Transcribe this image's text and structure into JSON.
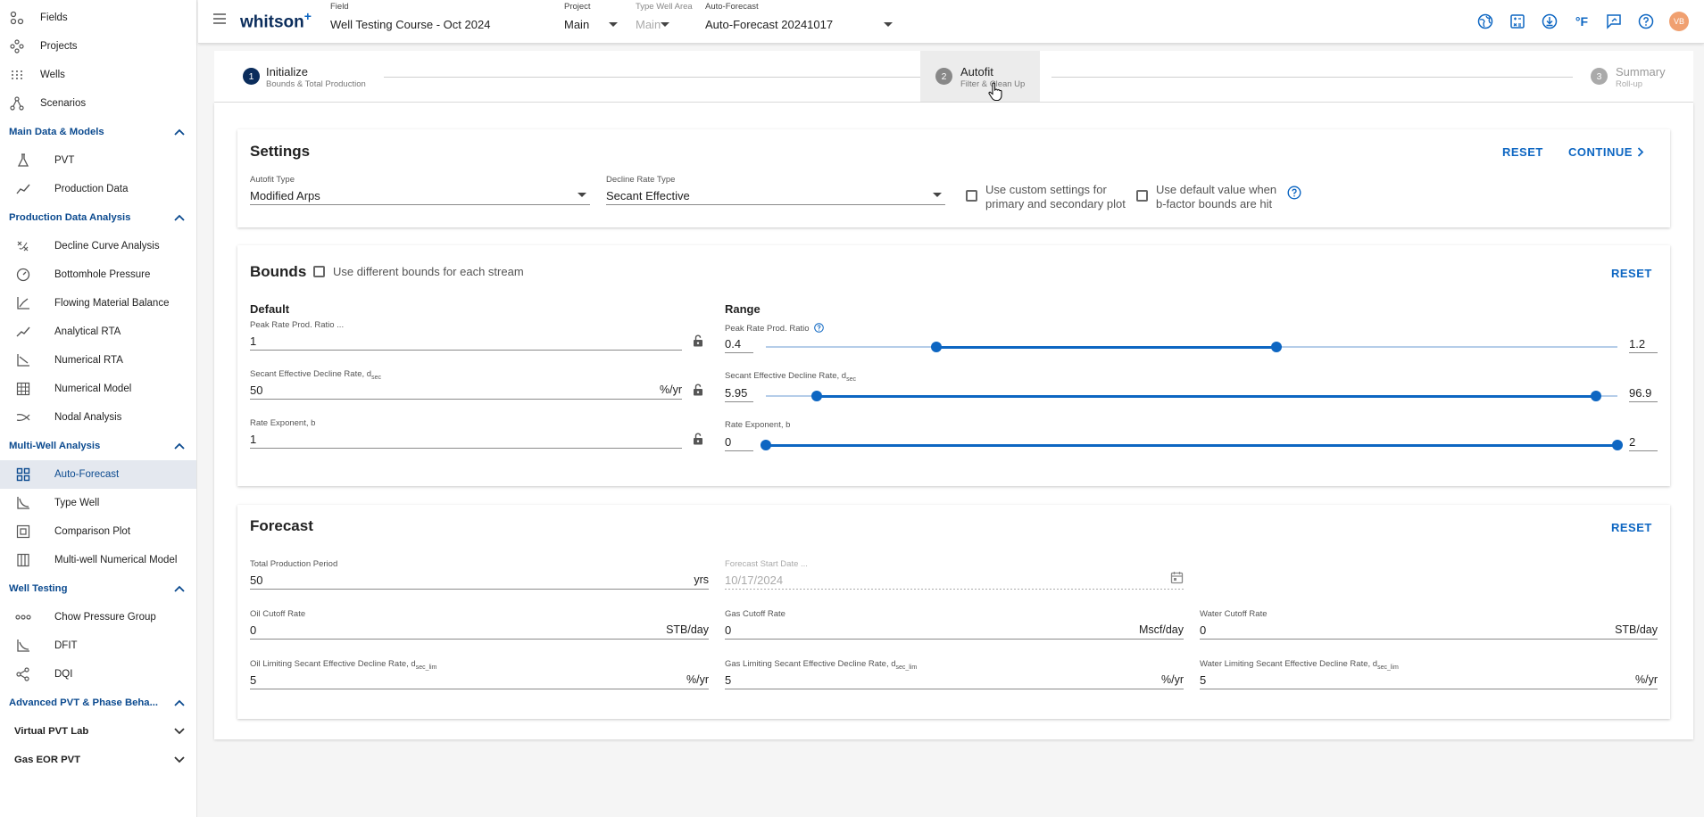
{
  "sidebar": {
    "top_items": [
      {
        "label": "Fields",
        "icon": "fields-icon"
      },
      {
        "label": "Projects",
        "icon": "projects-icon"
      },
      {
        "label": "Wells",
        "icon": "wells-icon"
      },
      {
        "label": "Scenarios",
        "icon": "scenarios-icon"
      }
    ],
    "sections": {
      "main_data": {
        "label": "Main Data & Models",
        "items": [
          {
            "label": "PVT"
          },
          {
            "label": "Production Data"
          }
        ]
      },
      "pda": {
        "label": "Production Data Analysis",
        "items": [
          {
            "label": "Decline Curve Analysis"
          },
          {
            "label": "Bottomhole Pressure"
          },
          {
            "label": "Flowing Material Balance"
          },
          {
            "label": "Analytical RTA"
          },
          {
            "label": "Numerical RTA"
          },
          {
            "label": "Numerical Model"
          },
          {
            "label": "Nodal Analysis"
          }
        ]
      },
      "mwa": {
        "label": "Multi-Well Analysis",
        "items": [
          {
            "label": "Auto-Forecast"
          },
          {
            "label": "Type Well"
          },
          {
            "label": "Comparison Plot"
          },
          {
            "label": "Multi-well Numerical Model"
          }
        ]
      },
      "wt": {
        "label": "Well Testing",
        "items": [
          {
            "label": "Chow Pressure Group"
          },
          {
            "label": "DFIT"
          },
          {
            "label": "DQI"
          }
        ]
      },
      "adv": {
        "label": "Advanced PVT & Phase Beha..."
      }
    },
    "collapsed": [
      {
        "label": "Virtual PVT Lab"
      },
      {
        "label": "Gas EOR PVT"
      }
    ]
  },
  "topbar": {
    "logo": "whitson",
    "logo_plus": "+",
    "field": {
      "caption": "Field",
      "value": "Well Testing Course - Oct 2024"
    },
    "project": {
      "caption": "Project",
      "value": "Main"
    },
    "type_well_area": {
      "caption": "Type Well Area",
      "value": "Main"
    },
    "auto_forecast": {
      "caption": "Auto-Forecast",
      "value": "Auto-Forecast 20241017"
    },
    "temp_unit": "°F",
    "avatar": "VB",
    "accent": "#0d66c2",
    "avatar_color": "#f0a070"
  },
  "stepper": {
    "steps": [
      {
        "number": "1",
        "title": "Initialize",
        "subtitle": "Bounds & Total Production"
      },
      {
        "number": "2",
        "title": "Autofit",
        "subtitle": "Filter & Clean Up"
      },
      {
        "number": "3",
        "title": "Summary",
        "subtitle": "Roll-up"
      }
    ]
  },
  "settings": {
    "title": "Settings",
    "reset": "RESET",
    "continue": "CONTINUE",
    "autofit_type": {
      "caption": "Autofit Type",
      "value": "Modified Arps"
    },
    "decline_rate_type": {
      "caption": "Decline Rate Type",
      "value": "Secant Effective"
    },
    "custom_settings": {
      "line1": "Use custom settings for",
      "line2": "primary and secondary plot",
      "checked": false
    },
    "default_value": {
      "line1": "Use default value when",
      "line2": "b-factor bounds are hit",
      "checked": false
    }
  },
  "bounds": {
    "title": "Bounds",
    "reset": "RESET",
    "diff_bounds_label": "Use different bounds for each stream",
    "default_head": "Default",
    "range_head": "Range",
    "default_fields": [
      {
        "caption": "Peak Rate Prod. Ratio ...",
        "value": "1",
        "unit": ""
      },
      {
        "caption_main": "Secant Effective Decline Rate, d",
        "caption_sub": "sec",
        "value": "50",
        "unit": "%/yr"
      },
      {
        "caption": "Rate Exponent, b",
        "value": "1",
        "unit": ""
      }
    ],
    "ranges": [
      {
        "caption": "Peak Rate Prod. Ratio",
        "min": "0.4",
        "max": "1.2",
        "low_frac": 0.2,
        "high_frac": 0.6
      },
      {
        "caption_main": "Secant Effective Decline Rate, d",
        "caption_sub": "sec",
        "min": "5.95",
        "max": "96.9",
        "low_frac": 0.06,
        "high_frac": 0.975
      },
      {
        "caption": "Rate Exponent, b",
        "min": "0",
        "max": "2",
        "low_frac": 0.0,
        "high_frac": 1.0
      }
    ]
  },
  "forecast": {
    "title": "Forecast",
    "reset": "RESET",
    "total_period": {
      "caption": "Total Production Period",
      "value": "50",
      "unit": "yrs"
    },
    "start_date": {
      "caption": "Forecast Start Date ...",
      "value": "10/17/2024"
    },
    "oil_cutoff": {
      "caption": "Oil Cutoff Rate",
      "value": "0",
      "unit": "STB/day"
    },
    "gas_cutoff": {
      "caption": "Gas Cutoff Rate",
      "value": "0",
      "unit": "Mscf/day"
    },
    "water_cutoff": {
      "caption": "Water Cutoff Rate",
      "value": "0",
      "unit": "STB/day"
    },
    "oil_limit": {
      "caption_main": "Oil Limiting Secant Effective Decline Rate, d",
      "caption_sub": "sec_lim",
      "value": "5",
      "unit": "%/yr"
    },
    "gas_limit": {
      "caption_main": "Gas Limiting Secant Effective Decline Rate, d",
      "caption_sub": "sec_lim",
      "value": "5",
      "unit": "%/yr"
    },
    "water_limit": {
      "caption_main": "Water Limiting Secant Effective Decline Rate, d",
      "caption_sub": "sec_lim",
      "value": "5",
      "unit": "%/yr"
    }
  }
}
